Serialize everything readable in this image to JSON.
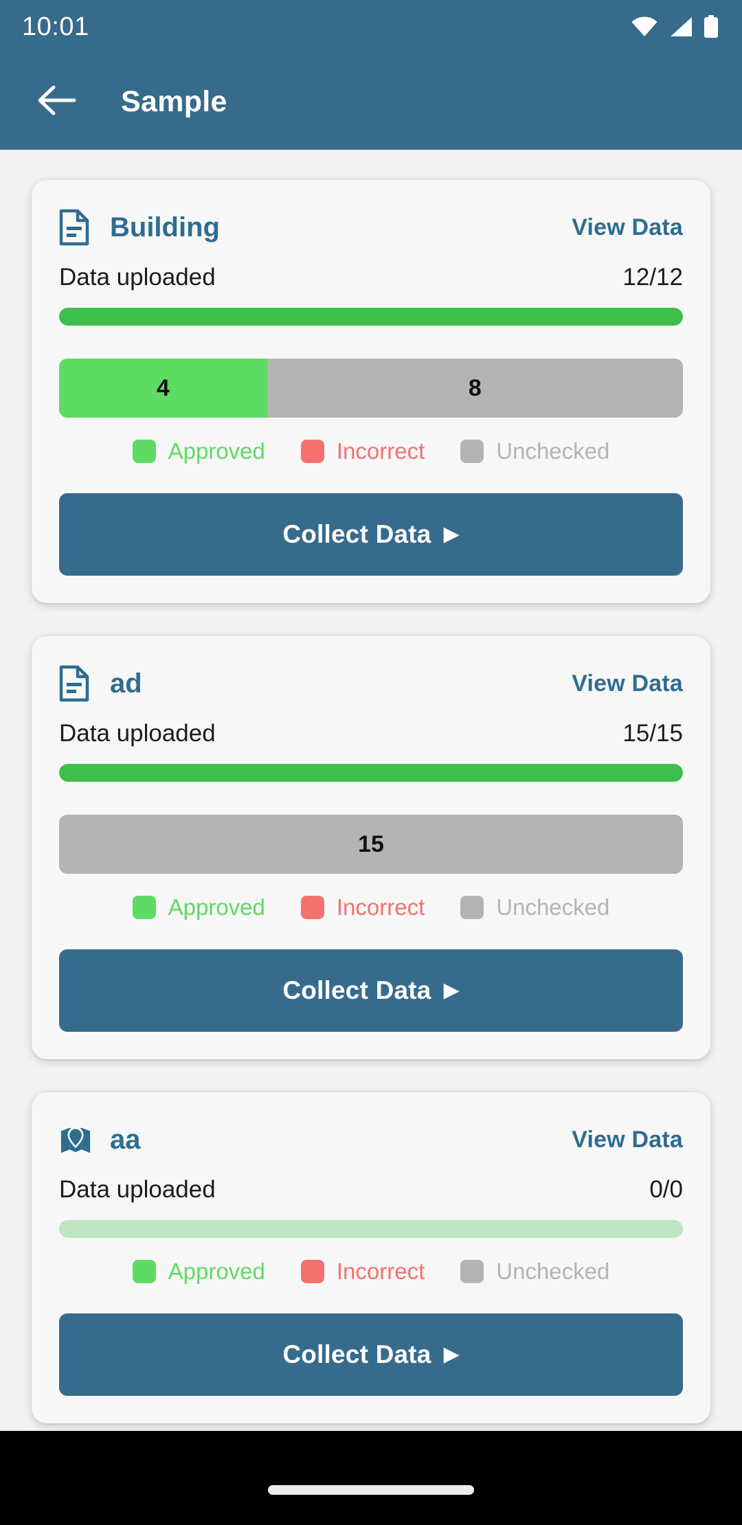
{
  "status_bar": {
    "time": "10:01",
    "icons": [
      "wifi-icon",
      "cellular-signal-icon",
      "battery-icon"
    ]
  },
  "app_bar": {
    "back_icon": "back-arrow-icon",
    "title": "Sample"
  },
  "legend": {
    "approved": {
      "label": "Approved",
      "color": "#5EDB63"
    },
    "incorrect": {
      "label": "Incorrect",
      "color": "#F4716E"
    },
    "unchecked": {
      "label": "Unchecked",
      "color": "#B4B4B4"
    }
  },
  "labels": {
    "data_uploaded": "Data uploaded",
    "view_data": "View Data",
    "collect_data": "Collect Data",
    "caret": "▶"
  },
  "theme": {
    "header": "#376B8B",
    "accent": "#2F6D8E",
    "progress_fill": "#3EBE4A",
    "progress_track": "#BFE5C2",
    "page_bg": "#F3F3F3",
    "card_bg": "#F7F7F7"
  },
  "cards": [
    {
      "icon": "document-icon",
      "title": "Building",
      "view_data": "View Data",
      "uploaded_label": "Data uploaded",
      "uploaded_count": "12/12",
      "progress_percent": 100,
      "segments": [
        {
          "type": "approved",
          "value": "4",
          "count": 4
        },
        {
          "type": "unchecked",
          "value": "8",
          "count": 8
        }
      ],
      "legend": [
        "Approved",
        "Incorrect",
        "Unchecked"
      ],
      "collect_label": "Collect Data"
    },
    {
      "icon": "document-icon",
      "title": "ad",
      "view_data": "View Data",
      "uploaded_label": "Data uploaded",
      "uploaded_count": "15/15",
      "progress_percent": 100,
      "segments": [
        {
          "type": "unchecked",
          "value": "15",
          "count": 15
        }
      ],
      "legend": [
        "Approved",
        "Incorrect",
        "Unchecked"
      ],
      "collect_label": "Collect Data"
    },
    {
      "icon": "map-pin-icon",
      "title": "aa",
      "view_data": "View Data",
      "uploaded_label": "Data uploaded",
      "uploaded_count": "0/0",
      "progress_percent": 0,
      "segments": [],
      "legend": [
        "Approved",
        "Incorrect",
        "Unchecked"
      ],
      "collect_label": "Collect Data"
    }
  ]
}
